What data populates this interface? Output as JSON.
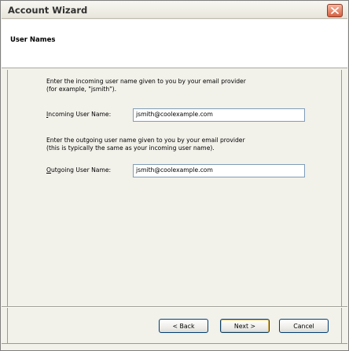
{
  "window": {
    "title": "Account Wizard",
    "close_label": "Close"
  },
  "header": {
    "title": "User Names"
  },
  "incoming": {
    "description_line1": "Enter the incoming user name given to you by your email provider",
    "description_line2": "(for example, \"jsmith\").",
    "label_accel": "I",
    "label_rest": "ncoming User Name:",
    "value": "jsmith@coolexample.com"
  },
  "outgoing": {
    "description_line1": "Enter the outgoing user name given to you by your email provider",
    "description_line2": "(this is typically the same as your incoming user name).",
    "label_accel": "O",
    "label_rest": "utgoing User Name:",
    "value": "jsmith@coolexample.com"
  },
  "buttons": {
    "back": "< Back",
    "next": "Next >",
    "cancel": "Cancel"
  }
}
